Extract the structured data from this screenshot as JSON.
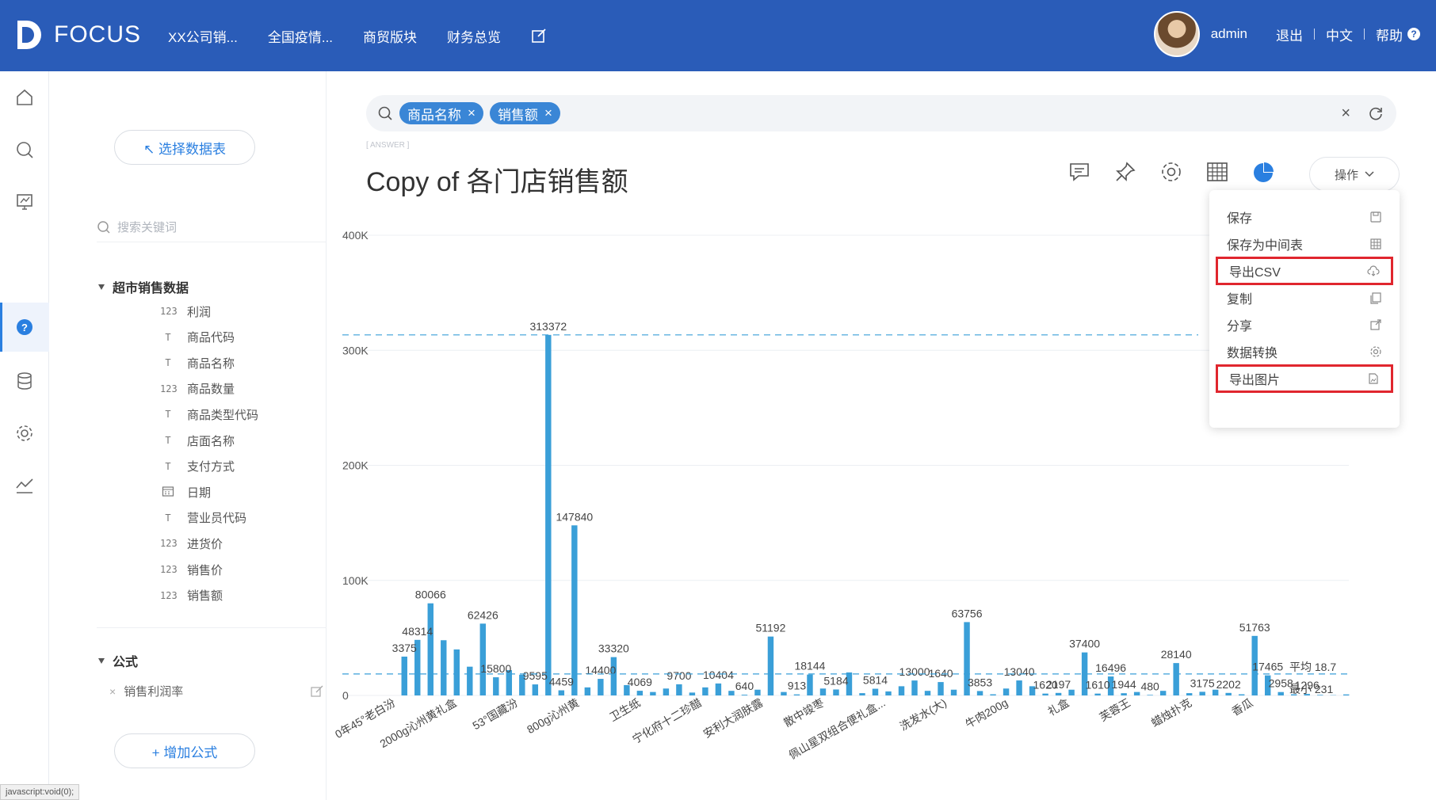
{
  "topbar": {
    "logo_text": "FOCUS",
    "nav": [
      "XX公司销...",
      "全国疫情...",
      "商贸版块",
      "财务总览"
    ],
    "user": "admin",
    "logout": "退出",
    "lang": "中文",
    "help": "帮助",
    "help_icon": "?"
  },
  "sidebar": {
    "select_table": "↖ 选择数据表",
    "search_placeholder": "搜索关键词",
    "group_title": "超市销售数据",
    "fields": [
      {
        "type": "123",
        "name": "利润"
      },
      {
        "type": "T",
        "name": "商品代码"
      },
      {
        "type": "T",
        "name": "商品名称"
      },
      {
        "type": "123",
        "name": "商品数量"
      },
      {
        "type": "T",
        "name": "商品类型代码"
      },
      {
        "type": "T",
        "name": "店面名称"
      },
      {
        "type": "T",
        "name": "支付方式"
      },
      {
        "type": "cal",
        "name": "日期"
      },
      {
        "type": "T",
        "name": "营业员代码"
      },
      {
        "type": "123",
        "name": "进货价"
      },
      {
        "type": "123",
        "name": "销售价"
      },
      {
        "type": "123",
        "name": "销售额"
      }
    ],
    "formula_title": "公式",
    "formula_item": "销售利润率",
    "add_formula": "+ 增加公式"
  },
  "search": {
    "chips": [
      "商品名称",
      "销售额"
    ]
  },
  "answer_tag": "[ ANSWER ]",
  "title": "Copy of 各门店销售额",
  "op_button": "操作",
  "menu": {
    "items": [
      "保存",
      "保存为中间表",
      "导出CSV",
      "复制",
      "分享",
      "数据转换",
      "导出图片"
    ]
  },
  "status_bar": "javascript:void(0);",
  "colors": {
    "topbar": "#2a5cb8",
    "bar": "#3a9fd8",
    "highlight": "#e0262e"
  },
  "chart_data": {
    "type": "bar",
    "y_ticks": [
      "400K",
      "300K",
      "200K",
      "100K",
      "0"
    ],
    "ylim": [
      0,
      400000
    ],
    "avg_label": "平均 18.7",
    "min_label": "最小 231",
    "avg_value": 18700,
    "x_tick_labels": [
      "0年45°老白汾",
      "2000g沁州黄礼盒",
      "53°国藏汾",
      "800g沁州黄",
      "卫生纸",
      "宁化府十二珍醋",
      "安利大润肤露",
      "散中竣枣",
      "佩山星双组合便礼盒...",
      "洗发水(大)",
      "牛肉200g",
      "礼盒",
      "芙蓉王",
      "蜡烛扑克",
      "香瓜"
    ],
    "values": [
      33759,
      48314,
      80066,
      48000,
      40000,
      25000,
      62426,
      15800,
      22000,
      18000,
      9595,
      313372,
      4459,
      147840,
      7000,
      14400,
      33320,
      9000,
      4069,
      3000,
      6000,
      9700,
      2500,
      7000,
      10404,
      4000,
      640,
      5000,
      51192,
      3000,
      913,
      18144,
      6000,
      5184,
      20000,
      2000,
      5814,
      3500,
      8000,
      13000,
      4000,
      11640,
      5000,
      63756,
      3853,
      1000,
      6000,
      13040,
      8000,
      1620,
      2197,
      5000,
      37400,
      1610,
      16496,
      1944,
      3000,
      480,
      4000,
      28140,
      2000,
      3175,
      5000,
      2202,
      1000,
      51763,
      17465,
      2958,
      1000,
      1296,
      500,
      231,
      900
    ],
    "data_labels": [
      {
        "i": 0,
        "text": "3375"
      },
      {
        "i": 1,
        "text": "48314"
      },
      {
        "i": 2,
        "text": "80066"
      },
      {
        "i": 6,
        "text": "62426"
      },
      {
        "i": 7,
        "text": "15800"
      },
      {
        "i": 10,
        "text": "9595"
      },
      {
        "i": 11,
        "text": "313372"
      },
      {
        "i": 12,
        "text": "4459"
      },
      {
        "i": 13,
        "text": "147840"
      },
      {
        "i": 15,
        "text": "14400"
      },
      {
        "i": 16,
        "text": "33320"
      },
      {
        "i": 18,
        "text": "4069"
      },
      {
        "i": 21,
        "text": "9700"
      },
      {
        "i": 24,
        "text": "10404"
      },
      {
        "i": 26,
        "text": "640"
      },
      {
        "i": 28,
        "text": "51192"
      },
      {
        "i": 30,
        "text": "913"
      },
      {
        "i": 31,
        "text": "18144"
      },
      {
        "i": 33,
        "text": "5184"
      },
      {
        "i": 36,
        "text": "5814"
      },
      {
        "i": 39,
        "text": "13000"
      },
      {
        "i": 41,
        "text": "1640"
      },
      {
        "i": 43,
        "text": "63756"
      },
      {
        "i": 44,
        "text": "3853"
      },
      {
        "i": 47,
        "text": "13040"
      },
      {
        "i": 49,
        "text": "1620"
      },
      {
        "i": 50,
        "text": "2197"
      },
      {
        "i": 52,
        "text": "37400"
      },
      {
        "i": 53,
        "text": "1610"
      },
      {
        "i": 54,
        "text": "16496"
      },
      {
        "i": 55,
        "text": "1944"
      },
      {
        "i": 57,
        "text": "480"
      },
      {
        "i": 59,
        "text": "28140"
      },
      {
        "i": 61,
        "text": "3175"
      },
      {
        "i": 63,
        "text": "2202"
      },
      {
        "i": 65,
        "text": "51763"
      },
      {
        "i": 66,
        "text": "17465"
      },
      {
        "i": 67,
        "text": "2958"
      },
      {
        "i": 69,
        "text": "1296"
      }
    ]
  }
}
